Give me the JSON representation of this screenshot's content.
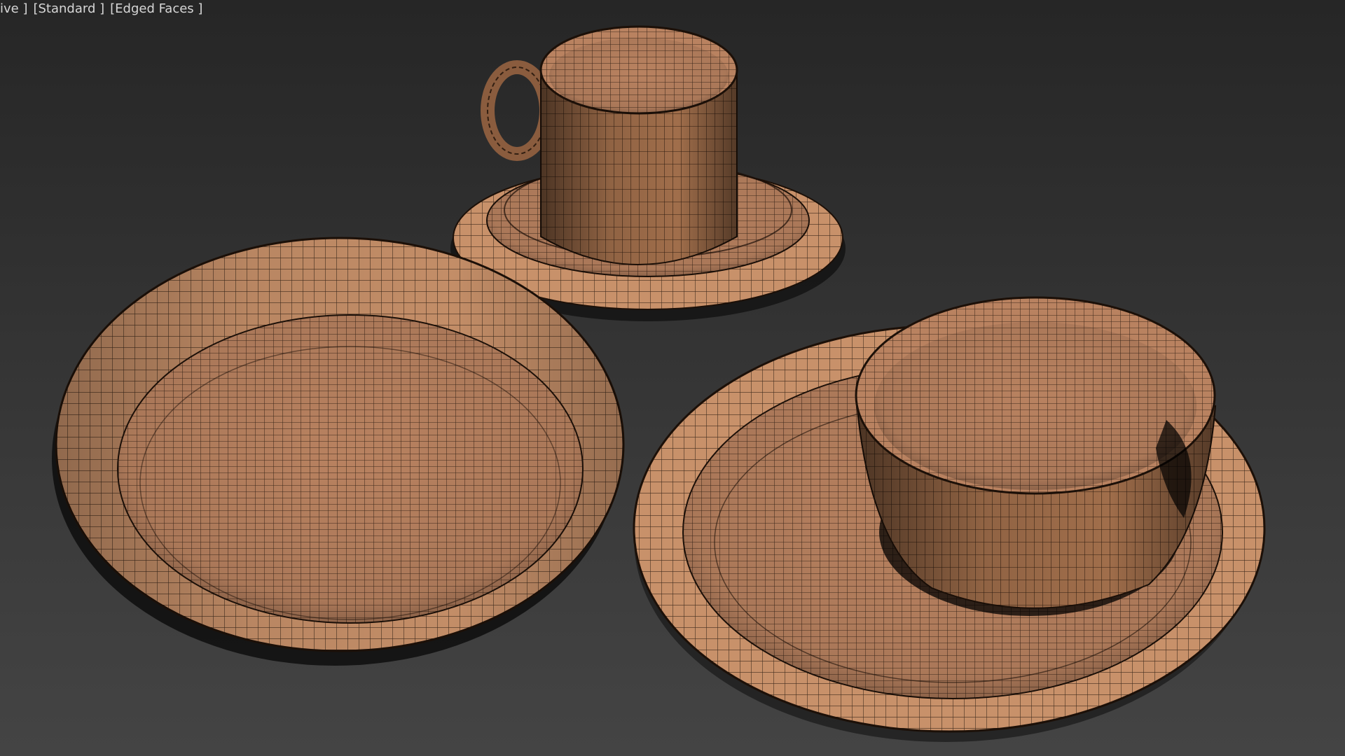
{
  "viewport": {
    "labels": {
      "view": "ive ]",
      "shading": "[Standard ]",
      "edged": "[Edged Faces ]"
    }
  },
  "colors": {
    "background_top": "#262626",
    "background_bottom": "#444444",
    "material": "#c8916a",
    "material_dark": "#7a5238",
    "wire": "#2a1a10",
    "shadow": "#0d0d0d"
  },
  "scene_objects": [
    "mug",
    "saucer",
    "deep-dish",
    "dinner-plate",
    "small-bowl"
  ]
}
